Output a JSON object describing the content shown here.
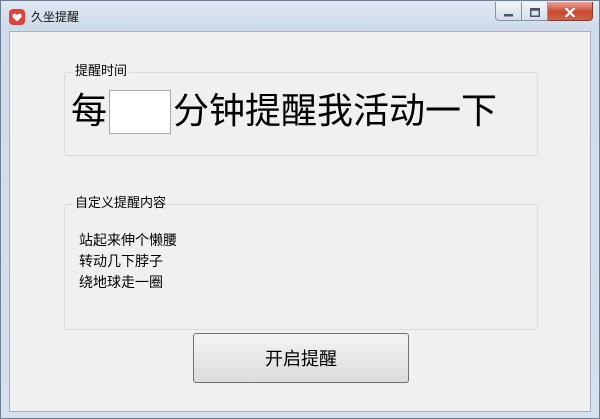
{
  "window": {
    "title": "久坐提醒",
    "icon": "heart-icon",
    "controls": [
      "minimize-icon",
      "maximize-icon",
      "close-icon"
    ],
    "close_color": "#c7482e"
  },
  "time_group": {
    "legend": "提醒时间",
    "prefix": "每",
    "minutes_value": "",
    "suffix": "分钟提醒我活动一下"
  },
  "content_group": {
    "legend": "自定义提醒内容",
    "lines": [
      "站起来伸个懒腰",
      "转动几下脖子",
      "绕地球走一圈"
    ]
  },
  "start_button": {
    "label": "开启提醒"
  }
}
